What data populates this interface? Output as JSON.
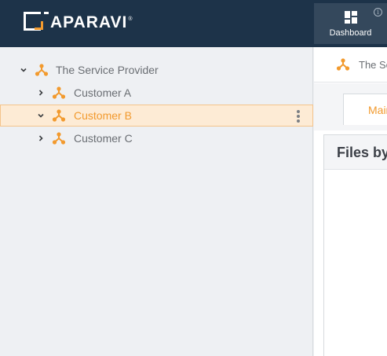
{
  "brand": {
    "name": "APARAVI",
    "reg": "®",
    "accent_color": "#f29a2e",
    "header_bg": "#1d3349"
  },
  "header": {
    "dashboard_label": "Dashboard",
    "info_glyph": "i"
  },
  "tree": {
    "root": {
      "label": "The Service Provider",
      "icon": "network-node-icon",
      "expanded": true
    },
    "children": [
      {
        "label": "Customer A",
        "expanded": false,
        "selected": false
      },
      {
        "label": "Customer B",
        "expanded": true,
        "selected": true
      },
      {
        "label": "Customer C",
        "expanded": false,
        "selected": false
      }
    ]
  },
  "main": {
    "breadcrumb": "The Service Provider",
    "active_tab": "Main",
    "card_title": "Files by"
  }
}
